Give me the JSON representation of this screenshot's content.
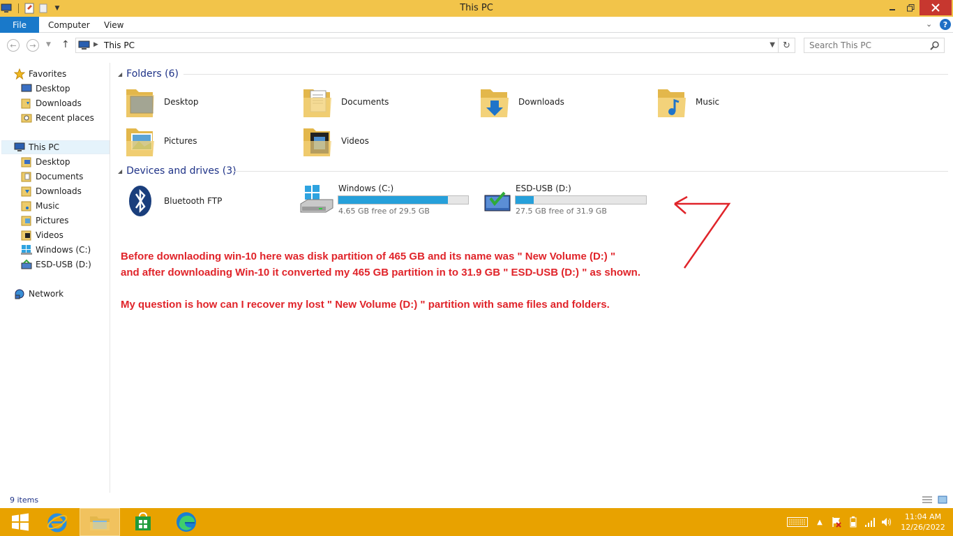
{
  "window": {
    "title": "This PC"
  },
  "ribbon": {
    "file_label": "File",
    "tabs": [
      "Computer",
      "View"
    ]
  },
  "address": {
    "path": "This PC",
    "search_placeholder": "Search This PC"
  },
  "nav": {
    "favorites": {
      "label": "Favorites",
      "items": [
        "Desktop",
        "Downloads",
        "Recent places"
      ]
    },
    "thispc": {
      "label": "This PC",
      "items": [
        "Desktop",
        "Documents",
        "Downloads",
        "Music",
        "Pictures",
        "Videos",
        "Windows (C:)",
        "ESD-USB (D:)"
      ]
    },
    "network": {
      "label": "Network"
    }
  },
  "folders": {
    "header": "Folders (6)",
    "items": [
      "Desktop",
      "Documents",
      "Downloads",
      "Music",
      "Pictures",
      "Videos"
    ]
  },
  "devices": {
    "header": "Devices and drives (3)",
    "bluetooth": "Bluetooth FTP",
    "drives": [
      {
        "name": "Windows (C:)",
        "free": "4.65 GB free of 29.5 GB",
        "used_fraction": 0.842
      },
      {
        "name": "ESD-USB (D:)",
        "free": "27.5 GB free of 31.9 GB",
        "used_fraction": 0.138
      }
    ]
  },
  "annotation": {
    "line1": "Before downlaoding win-10 here was disk partition of 465 GB and its name was \" New Volume (D:) \"",
    "line2": "and after downloading Win-10 it converted my 465 GB partition in to 31.9 GB \" ESD-USB (D:) \" as shown.",
    "line3": "My question is how can I recover my lost \" New Volume (D:) \" partition with same files and folders.",
    "color": "#e0242a"
  },
  "status": {
    "count": "9 items"
  },
  "taskbar": {
    "time": "11:04 AM",
    "date": "12/26/2022"
  },
  "colors": {
    "titlebar": "#f2c44a",
    "taskbar": "#e8a200",
    "file_tab": "#1979ca",
    "drive_bar": "#26a0da"
  }
}
